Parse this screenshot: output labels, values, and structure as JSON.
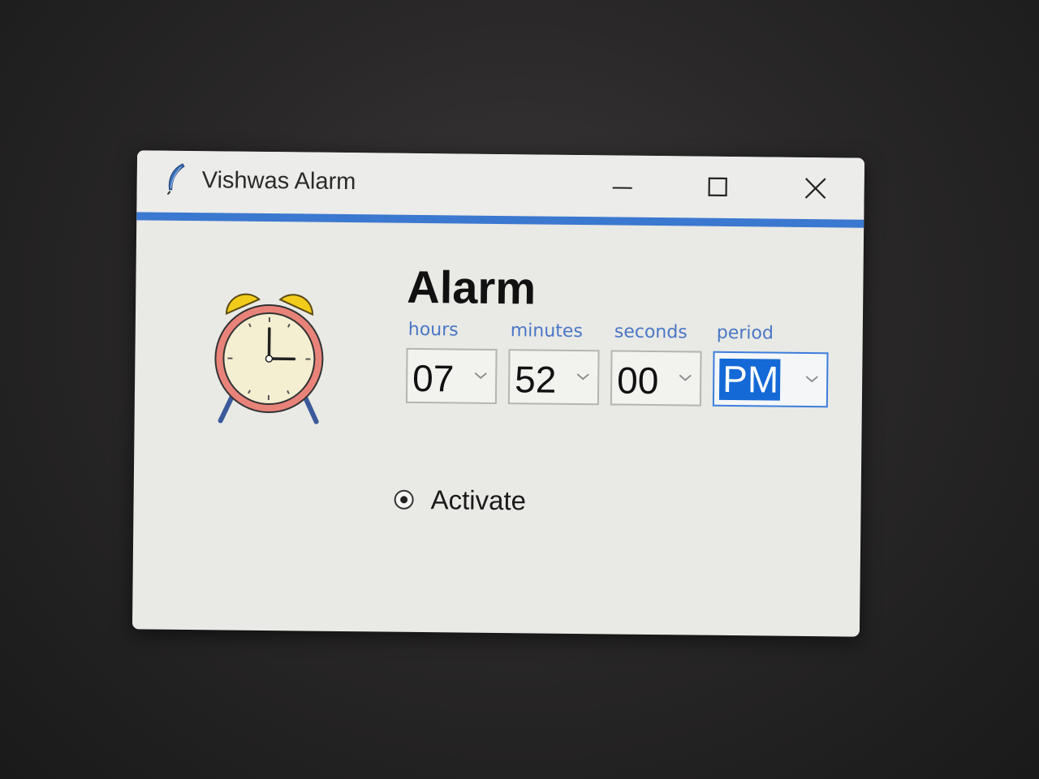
{
  "window": {
    "title": "Vishwas Alarm",
    "app_icon": "feather-icon",
    "controls": [
      "minimize-icon",
      "maximize-icon",
      "close-icon"
    ],
    "accent_color": "#3b78d0"
  },
  "main": {
    "clock_icon": "alarm-clock-icon",
    "heading": "Alarm",
    "fields": {
      "hours": {
        "label": "hours",
        "value": "07"
      },
      "minutes": {
        "label": "minutes",
        "value": "52"
      },
      "seconds": {
        "label": "seconds",
        "value": "00"
      },
      "period": {
        "label": "period",
        "value": "PM"
      }
    },
    "activate": {
      "label": "Activate",
      "selected": true
    }
  },
  "colors": {
    "label_blue": "#4a77c6",
    "selection_blue": "#1469d6"
  }
}
